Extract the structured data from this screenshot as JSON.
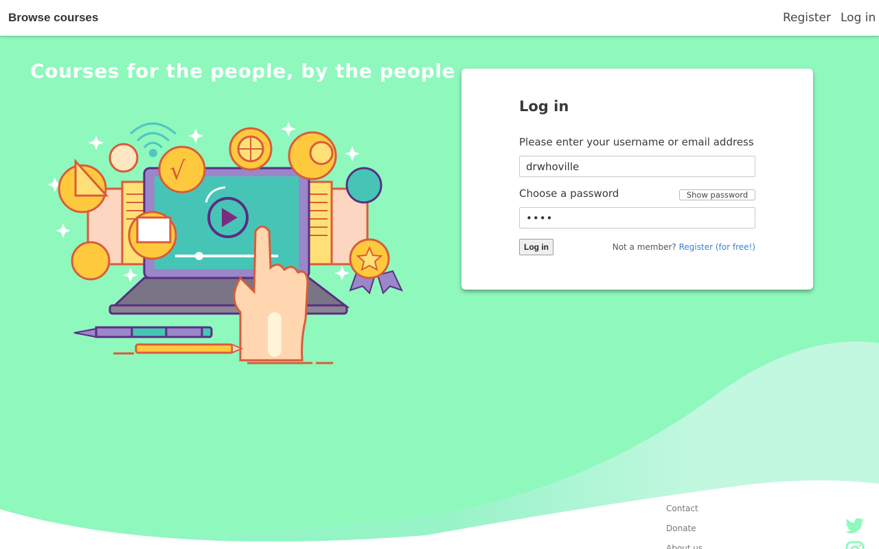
{
  "nav": {
    "brand": "Browse courses",
    "register": "Register",
    "login": "Log in"
  },
  "hero": {
    "title": "Courses for the people, by the people"
  },
  "login_card": {
    "title": "Log in",
    "username_label": "Please enter your username or email address",
    "username_value": "drwhoville",
    "password_label": "Choose a password",
    "password_value": "abcd",
    "show_password": "Show password",
    "submit": "Log in",
    "not_member": "Not a member?",
    "register_link": "Register (for free!)"
  },
  "footer": {
    "links": [
      "Contact",
      "Donate",
      "About us"
    ],
    "social": [
      "twitter-icon",
      "instagram-icon"
    ]
  },
  "colors": {
    "background": "#8ef8bd",
    "wave_light": "#c2f8e0",
    "accent_link": "#3b7fd4",
    "social": "#8ef8bd"
  }
}
